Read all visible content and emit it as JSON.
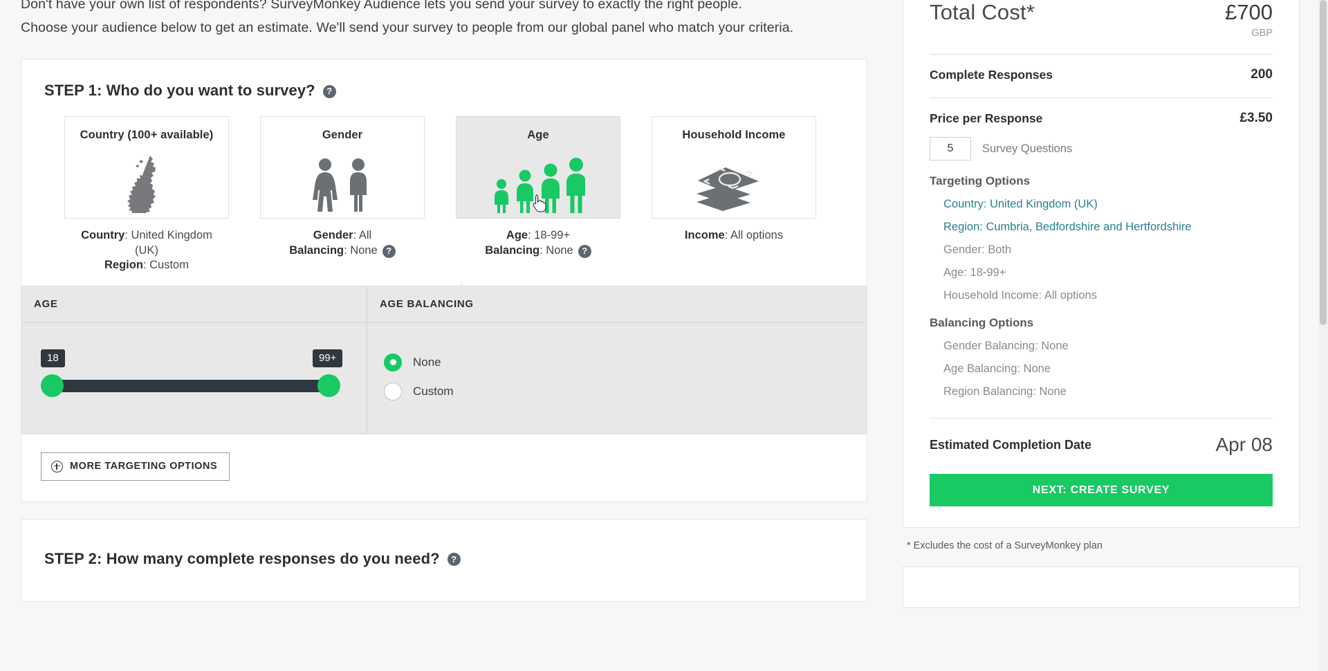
{
  "intro": {
    "line1": "Don't have your own list of respondents? SurveyMonkey Audience lets you send your survey to exactly the right people.",
    "line2": "Choose your audience below to get an estimate. We'll send your survey to people from our global panel who match your criteria."
  },
  "step1": {
    "title": "STEP 1: Who do you want to survey?",
    "help_icon": "question-mark-icon",
    "tiles": [
      {
        "title": "Country (100+ available)",
        "icon": "uk-map-icon",
        "selected": false,
        "caption": [
          {
            "label": "Country",
            "value": "United Kingdom"
          },
          {
            "value": "(UK)"
          },
          {
            "label": "Region",
            "value": "Custom"
          }
        ]
      },
      {
        "title": "Gender",
        "icon": "gender-figures-icon",
        "selected": false,
        "caption": [
          {
            "label": "Gender",
            "value": "All"
          },
          {
            "label": "Balancing",
            "value": "None",
            "help": true
          }
        ]
      },
      {
        "title": "Age",
        "icon": "age-figures-icon",
        "selected": true,
        "caption": [
          {
            "label": "Age",
            "value": "18-99+"
          },
          {
            "label": "Balancing",
            "value": "None",
            "help": true
          }
        ]
      },
      {
        "title": "Household Income",
        "icon": "banknotes-icon",
        "selected": false,
        "caption": [
          {
            "label": "Income",
            "value": "All options"
          }
        ]
      }
    ],
    "age_panel": {
      "header": "AGE",
      "min_label": "18",
      "max_label": "99+"
    },
    "balancing_panel": {
      "header": "AGE BALANCING",
      "options": [
        {
          "label": "None",
          "selected": true
        },
        {
          "label": "Custom",
          "selected": false
        }
      ]
    },
    "more_options_button": "MORE TARGETING OPTIONS",
    "more_options_icon": "plus-circle-icon"
  },
  "step2": {
    "title": "STEP 2: How many complete responses do you need?"
  },
  "summary": {
    "total_label": "Total Cost*",
    "total_amount": "£700",
    "currency": "GBP",
    "complete_responses_label": "Complete Responses",
    "complete_responses_value": "200",
    "price_per_response_label": "Price per Response",
    "price_per_response_value": "£3.50",
    "questions_value": "5",
    "questions_label": "Survey Questions",
    "targeting_title": "Targeting Options",
    "targeting_options": [
      {
        "text": "Country: United Kingdom (UK)",
        "link": true
      },
      {
        "text": "Region: Cumbria, Bedfordshire and Hertfordshire",
        "link": true
      },
      {
        "text": "Gender: Both",
        "link": false
      },
      {
        "text": "Age: 18-99+",
        "link": false
      },
      {
        "text": "Household Income: All options",
        "link": false
      }
    ],
    "balancing_title": "Balancing Options",
    "balancing_options": [
      {
        "text": "Gender Balancing: None"
      },
      {
        "text": "Age Balancing: None"
      },
      {
        "text": "Region Balancing: None"
      }
    ],
    "completion_label": "Estimated Completion Date",
    "completion_value": "Apr 08",
    "cta_label": "NEXT: CREATE SURVEY",
    "footnote": "* Excludes the cost of a SurveyMonkey plan"
  },
  "colors": {
    "accent_green": "#18c964",
    "link_teal": "#2a7f8f",
    "slider_track": "#2f3740",
    "selected_tile": "#e8e8e8"
  }
}
